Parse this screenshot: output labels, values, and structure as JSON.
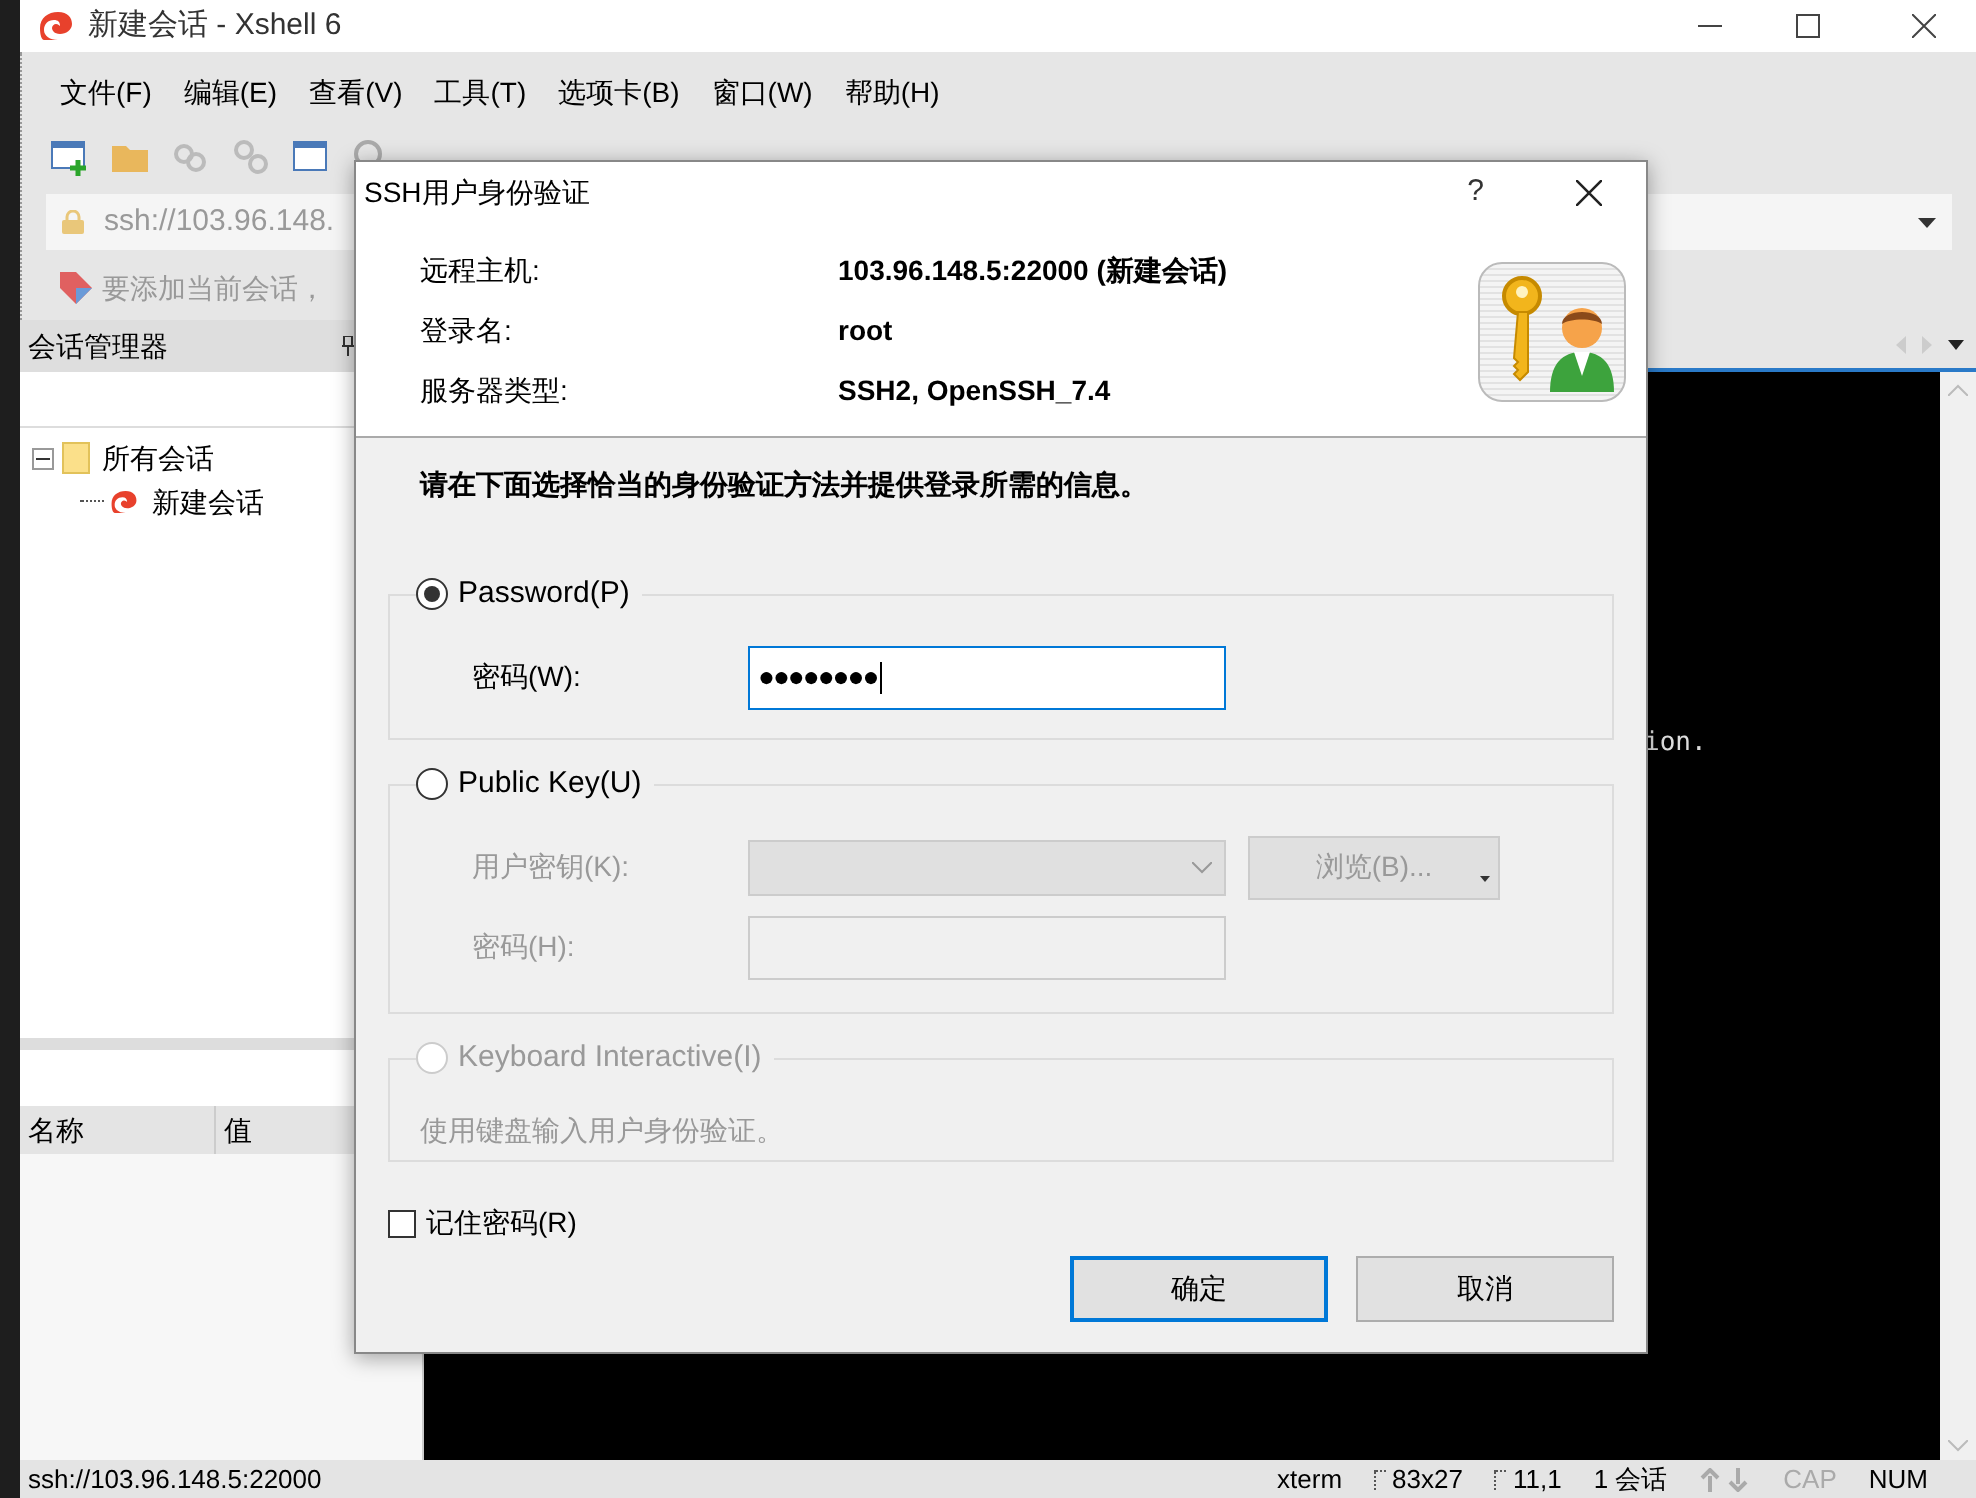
{
  "window": {
    "title": "新建会话 - Xshell 6"
  },
  "menu": [
    "文件(F)",
    "编辑(E)",
    "查看(V)",
    "工具(T)",
    "选项卡(B)",
    "窗口(W)",
    "帮助(H)"
  ],
  "address_bar": {
    "value": "ssh://103.96.148."
  },
  "hint_bar": {
    "text": "要添加当前会话，"
  },
  "session_manager": {
    "title": "会话管理器",
    "tree": [
      {
        "label": "所有会话",
        "expanded": true,
        "children": [
          {
            "label": "新建会话"
          }
        ]
      }
    ]
  },
  "properties": {
    "columns": [
      "名称",
      "值"
    ]
  },
  "terminal": {
    "lines": [
      "ion."
    ]
  },
  "status_bar": {
    "left": "ssh://103.96.148.5:22000",
    "items": [
      {
        "kind": "text",
        "text": "xterm"
      },
      {
        "kind": "size",
        "text": "83x27"
      },
      {
        "kind": "cursor",
        "text": "11,1"
      },
      {
        "kind": "text",
        "text": "1 会话"
      },
      {
        "kind": "arrows"
      },
      {
        "kind": "lock",
        "text": "CAP",
        "on": false
      },
      {
        "kind": "lock",
        "text": "NUM",
        "on": true
      }
    ]
  },
  "dialog": {
    "title": "SSH用户身份验证",
    "help": "?",
    "info": [
      {
        "label": "远程主机:",
        "value": "103.96.148.5:22000 (新建会话)"
      },
      {
        "label": "登录名:",
        "value": "root"
      },
      {
        "label": "服务器类型:",
        "value": "SSH2, OpenSSH_7.4"
      }
    ],
    "instruction": "请在下面选择恰当的身份验证方法并提供登录所需的信息。",
    "methods": [
      {
        "kind": "password",
        "label": "Password(P)",
        "selected": true,
        "disabled": false,
        "fields": [
          {
            "kind": "input",
            "label": "密码(W):",
            "value": "●●●●●●●●",
            "focused": true,
            "disabled": false
          }
        ]
      },
      {
        "kind": "publickey",
        "label": "Public Key(U)",
        "selected": false,
        "disabled": false,
        "fields": [
          {
            "kind": "select",
            "label": "用户密钥(K):",
            "disabled": true,
            "button": "浏览(B)..."
          },
          {
            "kind": "input",
            "label": "密码(H):",
            "focused": false,
            "disabled": true
          }
        ]
      },
      {
        "kind": "keyboard",
        "label": "Keyboard Interactive(I)",
        "selected": false,
        "disabled": true,
        "description": "使用键盘输入用户身份验证。"
      }
    ],
    "remember": {
      "label": "记住密码(R)",
      "checked": false
    },
    "buttons": [
      {
        "label": "确定",
        "default": true
      },
      {
        "label": "取消",
        "default": false
      }
    ]
  }
}
